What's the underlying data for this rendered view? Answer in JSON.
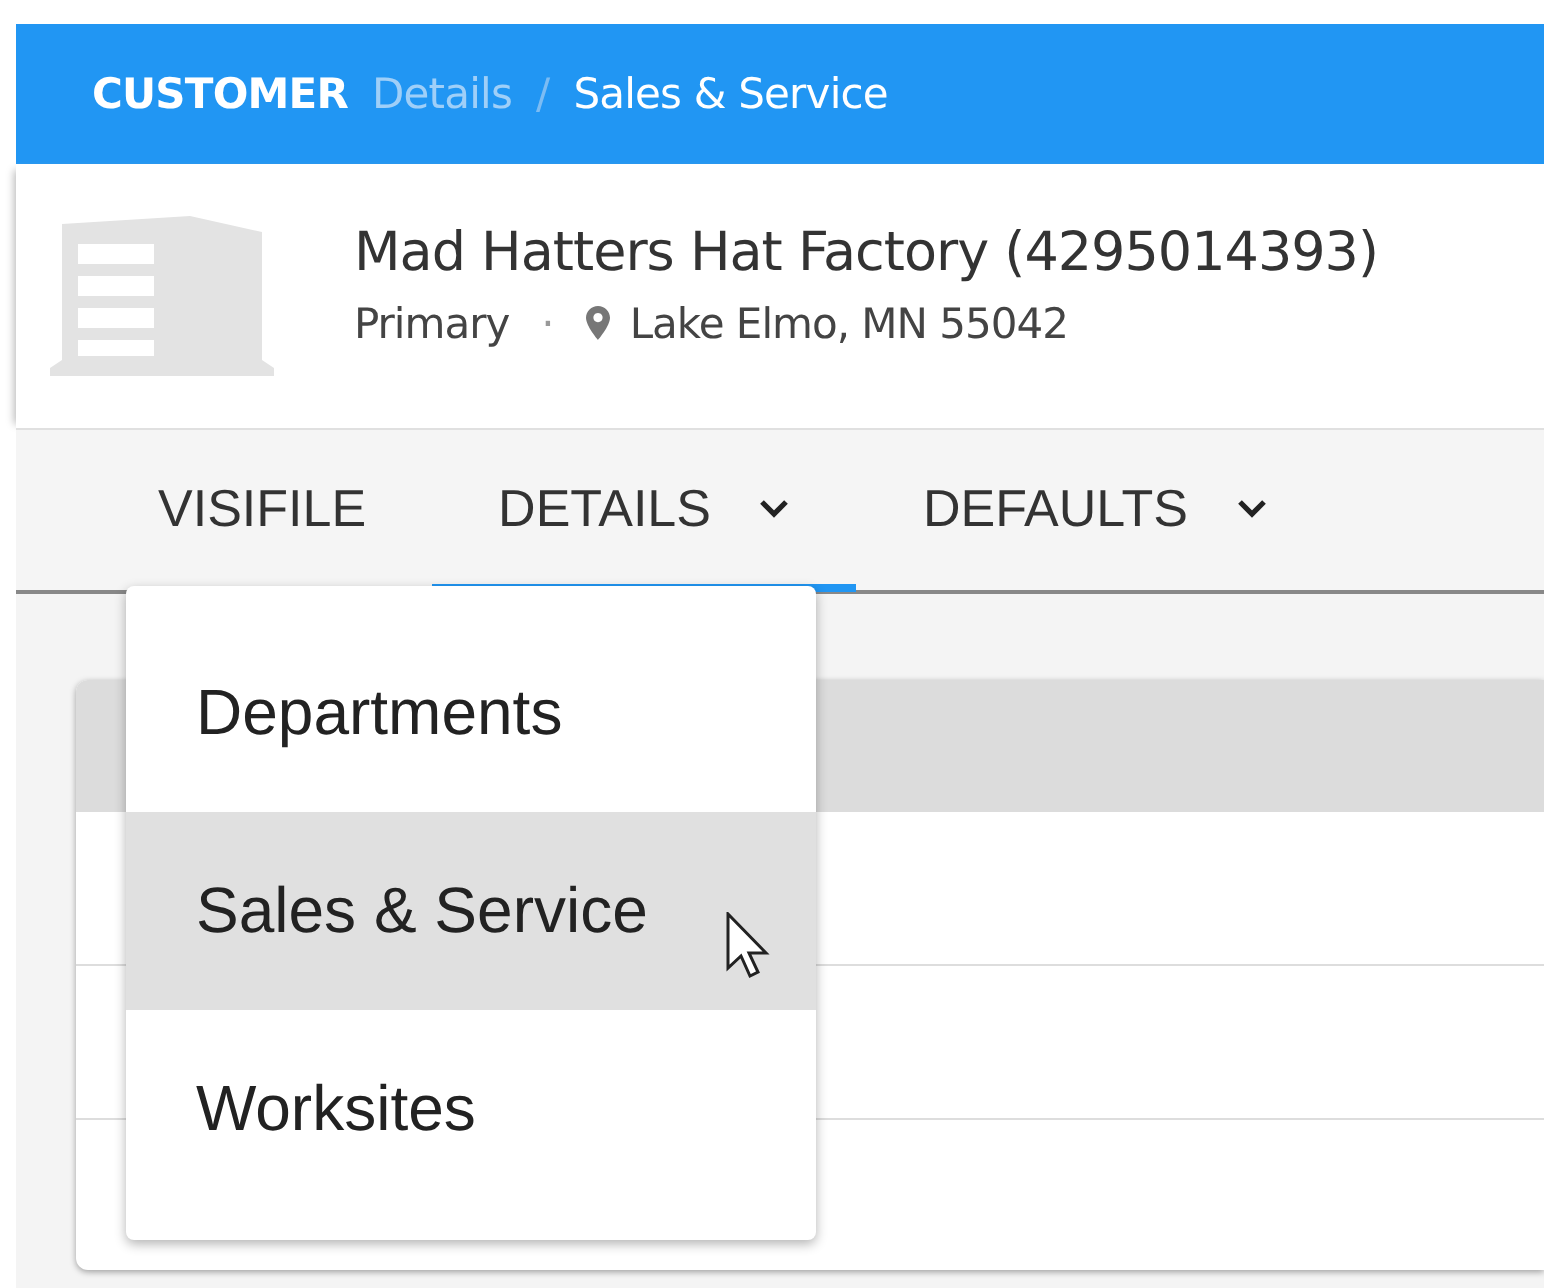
{
  "breadcrumb": {
    "section": "CUSTOMER",
    "items": [
      {
        "label": "Details",
        "current": false
      },
      {
        "label": "Sales & Service",
        "current": true
      }
    ],
    "separator": "/"
  },
  "customer": {
    "name": "Mad Hatters Hat Factory (4295014393)",
    "type": "Primary",
    "separator": "·",
    "location": "Lake Elmo, MN 55042"
  },
  "tabs": [
    {
      "label": "VISIFILE",
      "selected": false,
      "has_menu": false
    },
    {
      "label": "DETAILS",
      "selected": true,
      "has_menu": true
    },
    {
      "label": "DEFAULTS",
      "selected": false,
      "has_menu": true
    }
  ],
  "menu": {
    "items": [
      {
        "label": "Departments",
        "selected": false
      },
      {
        "label": "Sales & Service",
        "selected": true
      },
      {
        "label": "Worksites",
        "selected": false
      }
    ]
  }
}
